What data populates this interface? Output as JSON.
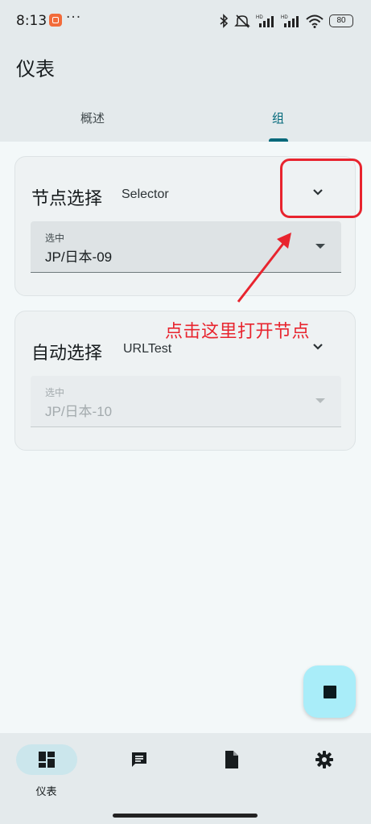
{
  "status_bar": {
    "time": "8:13",
    "more": "···",
    "hd1": "HD",
    "hd2": "HD",
    "battery": "80"
  },
  "header": {
    "title": "仪表",
    "tabs": [
      {
        "label": "概述",
        "active": false
      },
      {
        "label": "组",
        "active": true
      }
    ]
  },
  "groups": [
    {
      "name": "节点选择",
      "type": "Selector",
      "select_caption": "选中",
      "selected": "JP/日本-09",
      "enabled": true
    },
    {
      "name": "自动选择",
      "type": "URLTest",
      "select_caption": "选中",
      "selected": "JP/日本-10",
      "enabled": false
    }
  ],
  "annotation": {
    "text": "点击这里打开节点",
    "color": "#e8242e"
  },
  "fab": {
    "icon": "stop-icon"
  },
  "bottom_nav": {
    "items": [
      {
        "label": "仪表",
        "icon": "dashboard-icon",
        "active": true
      },
      {
        "label": "",
        "icon": "chat-icon",
        "active": false
      },
      {
        "label": "",
        "icon": "document-icon",
        "active": false
      },
      {
        "label": "",
        "icon": "settings-icon",
        "active": false
      }
    ]
  },
  "colors": {
    "accent": "#00687a",
    "fab_bg": "#a9edf9",
    "annotation_red": "#e8242e"
  }
}
